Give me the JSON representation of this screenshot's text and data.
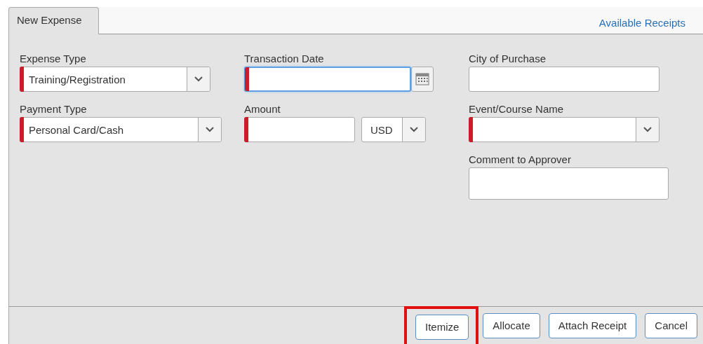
{
  "tab": {
    "label": "New Expense",
    "selected": true
  },
  "link": "Available Receipts",
  "columns": [
    [
      {
        "label": "Expense Type",
        "kind": "select",
        "value": "Training/Registration",
        "required": true,
        "focused": false
      },
      {
        "label": "Payment Type",
        "kind": "select",
        "value": "Personal Card/Cash",
        "required": true,
        "focused": false
      }
    ],
    [
      {
        "label": "Transaction Date",
        "kind": "date",
        "required": true,
        "focused": true
      },
      {
        "label": "Amount",
        "kind": "amount",
        "currency": "USD",
        "required": true,
        "focused": false
      }
    ],
    [
      {
        "label": "City of Purchase",
        "kind": "text",
        "required": false,
        "focused": false
      },
      {
        "label": "Event/Course Name",
        "kind": "select",
        "required": true,
        "focused": false
      },
      {
        "label": "Comment to Approver",
        "kind": "textarea",
        "required": false,
        "focused": false
      }
    ]
  ],
  "buttons": [
    {
      "label": "Itemize",
      "highlighted": true
    },
    {
      "label": "Allocate",
      "highlighted": false
    },
    {
      "label": "Attach Receipt",
      "highlighted": false
    },
    {
      "label": "Cancel",
      "highlighted": false
    }
  ]
}
